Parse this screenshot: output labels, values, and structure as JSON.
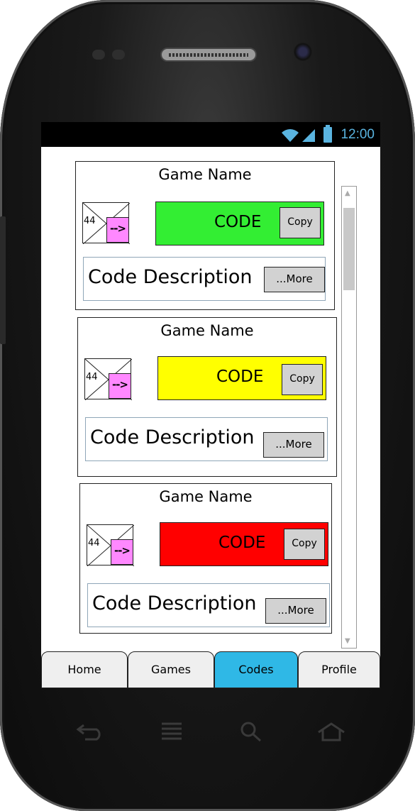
{
  "status_bar": {
    "time": "12:00"
  },
  "cards": [
    {
      "game_name": "Game Name",
      "thumb_number": "44",
      "thumb_arrow": "-->",
      "code": "CODE",
      "code_color": "#33ee33",
      "copy_label": "Copy",
      "description": "Code Description",
      "more_label": "...More"
    },
    {
      "game_name": "Game Name",
      "thumb_number": "44",
      "thumb_arrow": "-->",
      "code": "CODE",
      "code_color": "#ffff00",
      "copy_label": "Copy",
      "description": "Code Description",
      "more_label": "...More"
    },
    {
      "game_name": "Game Name",
      "thumb_number": "44",
      "thumb_arrow": "-->",
      "code": "CODE",
      "code_color": "#ff0000",
      "copy_label": "Copy",
      "description": "Code Description",
      "more_label": "...More"
    }
  ],
  "tabs": [
    {
      "label": "Home",
      "active": false
    },
    {
      "label": "Games",
      "active": false
    },
    {
      "label": "Codes",
      "active": true
    },
    {
      "label": "Profile",
      "active": false
    }
  ],
  "colors": {
    "active_tab": "#2fb8e6",
    "status_icons": "#5ab4e0",
    "thumb_arrow": "#ff88ff"
  }
}
